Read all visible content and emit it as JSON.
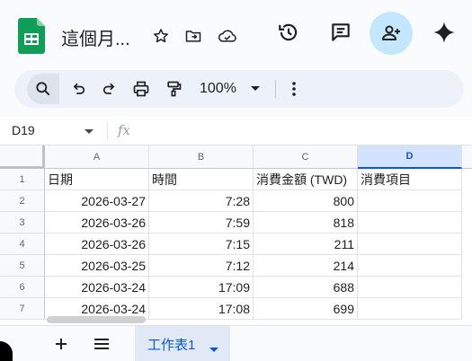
{
  "header": {
    "doc_title": "這個月...",
    "icons": [
      "sheets-logo",
      "star-icon",
      "move-to-folder-icon",
      "cloud-status-icon",
      "history-icon",
      "comments-icon",
      "share-add-person-icon",
      "gemini-sparkle-icon"
    ]
  },
  "toolbar": {
    "zoom": "100%",
    "icons": [
      "search-icon",
      "undo-icon",
      "redo-icon",
      "print-icon",
      "paint-format-icon",
      "zoom-dropdown-icon",
      "more-vert-icon"
    ]
  },
  "formula_bar": {
    "name_box": "D19",
    "fx_label": "fx",
    "content": ""
  },
  "grid": {
    "columns": [
      "A",
      "B",
      "C",
      "D"
    ],
    "selected_column": "D",
    "rows": [
      {
        "num": "1",
        "cells": [
          "日期",
          "時間",
          "消費金額 (TWD)",
          "消費項目"
        ]
      },
      {
        "num": "2",
        "cells": [
          "2026-03-27",
          "7:28",
          "800",
          ""
        ]
      },
      {
        "num": "3",
        "cells": [
          "2026-03-26",
          "7:59",
          "818",
          ""
        ]
      },
      {
        "num": "4",
        "cells": [
          "2026-03-26",
          "7:15",
          "211",
          ""
        ]
      },
      {
        "num": "5",
        "cells": [
          "2026-03-25",
          "7:12",
          "214",
          ""
        ]
      },
      {
        "num": "6",
        "cells": [
          "2026-03-24",
          "17:09",
          "688",
          ""
        ]
      },
      {
        "num": "7",
        "cells": [
          "2026-03-24",
          "17:08",
          "699",
          ""
        ]
      }
    ]
  },
  "sheets": {
    "active_tab": "工作表1",
    "icons": [
      "add-sheet-icon",
      "all-sheets-icon"
    ]
  },
  "colors": {
    "accent": "#0b57d0",
    "share_button": "#c2e7ff",
    "sheets_green": "#0f9d58",
    "selected_header": "#d3e3fd"
  }
}
